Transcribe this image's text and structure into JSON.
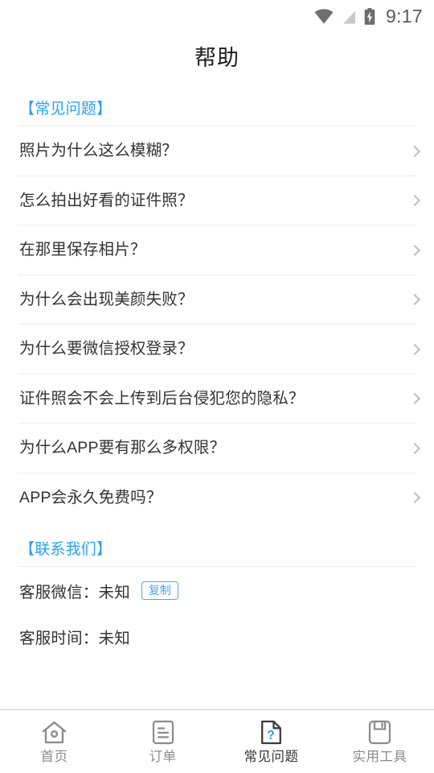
{
  "statusbar": {
    "time": "9:17",
    "icons": [
      "wifi-icon",
      "signal-off-icon",
      "battery-charging-icon"
    ]
  },
  "header": {
    "title": "帮助"
  },
  "faq_section": {
    "heading": "【常见问题】",
    "items": [
      {
        "label": "照片为什么这么模糊？",
        "chevron": "chevron-right-icon"
      },
      {
        "label": "怎么拍出好看的证件照？",
        "chevron": "chevron-right-icon"
      },
      {
        "label": "在那里保存相片？",
        "chevron": "chevron-right-icon"
      },
      {
        "label": "为什么会出现美颜失败？",
        "chevron": "chevron-right-icon"
      },
      {
        "label": "为什么要微信授权登录？",
        "chevron": "chevron-right-icon"
      },
      {
        "label": "证件照会不会上传到后台侵犯您的隐私？",
        "chevron": "chevron-right-icon"
      },
      {
        "label": "为什么APP要有那么多权限？",
        "chevron": "chevron-right-icon"
      },
      {
        "label": "APP会永久免费吗？",
        "chevron": "chevron-right-icon"
      }
    ]
  },
  "contact_section": {
    "heading": "【联系我们】",
    "wechat_label": "客服微信：未知",
    "copy_button": "复制",
    "hours_label": "客服时间：未知"
  },
  "tabbar": {
    "items": [
      {
        "label": "首页",
        "icon": "home-icon",
        "active": false
      },
      {
        "label": "订单",
        "icon": "order-document-icon",
        "active": false
      },
      {
        "label": "常见问题",
        "icon": "faq-question-document-icon",
        "active": true
      },
      {
        "label": "实用工具",
        "icon": "floppy-save-icon",
        "active": false
      }
    ]
  },
  "colors": {
    "accent_blue": "#29a1f2",
    "button_blue": "#45a8f5",
    "text_primary": "#333333",
    "text_muted": "#8b8b8b",
    "divider": "#ececec",
    "background": "#ffffff"
  }
}
